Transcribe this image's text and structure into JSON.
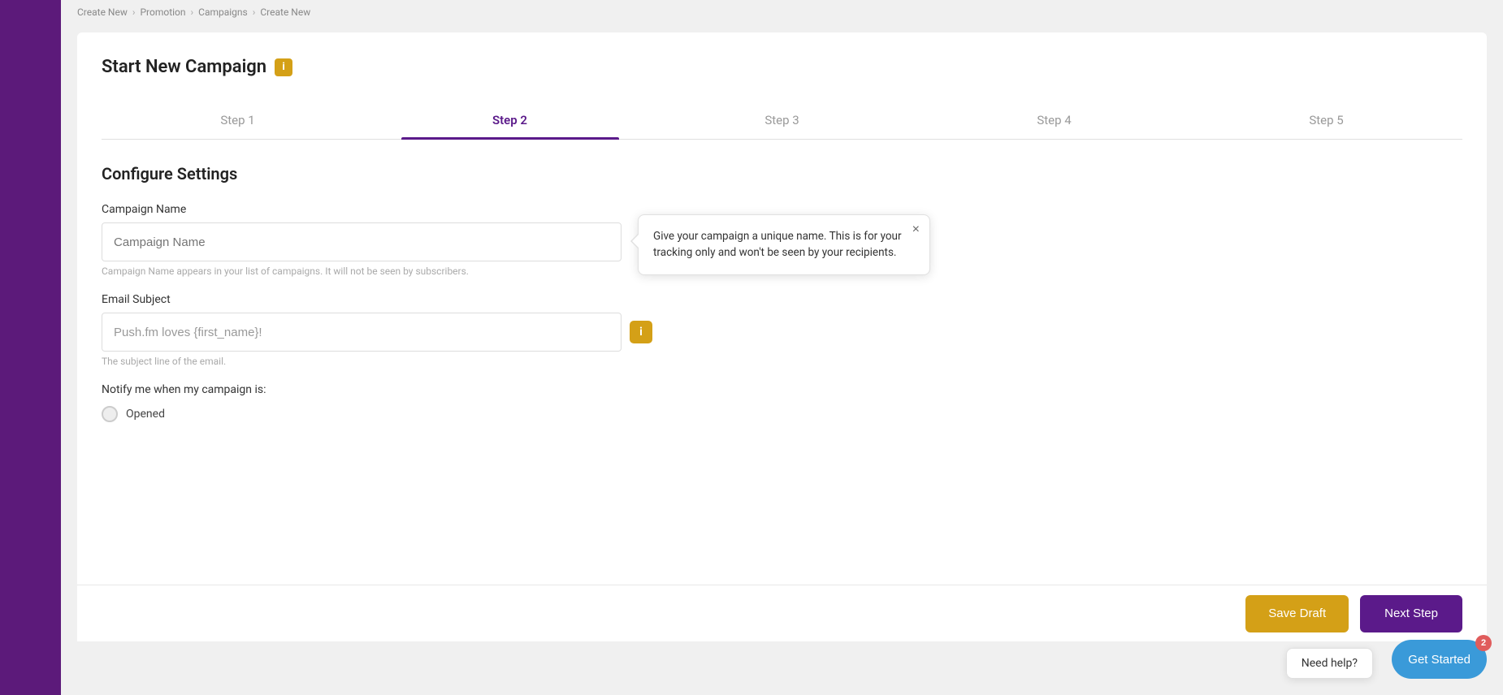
{
  "breadcrumb": {
    "items": [
      "Create New",
      "Promotion",
      "Campaigns",
      "Create New"
    ]
  },
  "page": {
    "title": "Start New Campaign",
    "info_icon_label": "i"
  },
  "steps": [
    {
      "label": "Step 1",
      "active": false
    },
    {
      "label": "Step 2",
      "active": true
    },
    {
      "label": "Step 3",
      "active": false
    },
    {
      "label": "Step 4",
      "active": false
    },
    {
      "label": "Step 5",
      "active": false
    }
  ],
  "form": {
    "section_title": "Configure Settings",
    "campaign_name": {
      "label": "Campaign Name",
      "placeholder": "Campaign Name",
      "hint": "Campaign Name appears in your list of campaigns. It will not be seen by subscribers.",
      "value": ""
    },
    "email_subject": {
      "label": "Email Subject",
      "placeholder": "",
      "hint": "The subject line of the email.",
      "value": "Push.fm loves {first_name}!"
    },
    "notify": {
      "label": "Notify me when my campaign is:",
      "checkbox_label": "Opened"
    }
  },
  "tooltip": {
    "text": "Give your campaign a unique name. This is for your tracking only and won't be seen by your recipients.",
    "close_icon": "×"
  },
  "actions": {
    "save_draft": "Save Draft",
    "next_step": "Next Step"
  },
  "get_started": {
    "label": "Get Started",
    "badge": "2"
  },
  "need_help": {
    "label": "Need help?"
  }
}
